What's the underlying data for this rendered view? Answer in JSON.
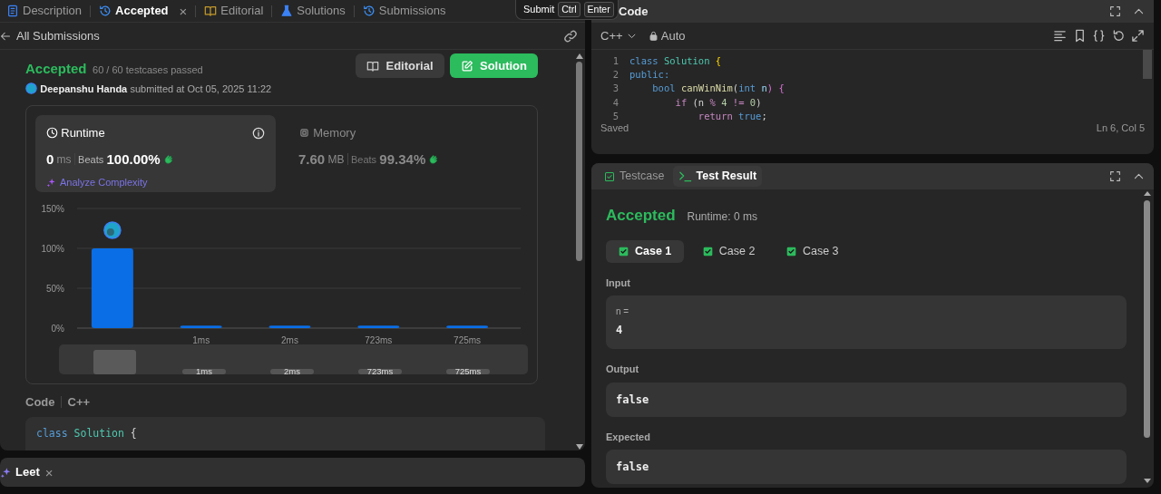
{
  "left_tabs": [
    {
      "label": "Description",
      "kind": "description",
      "selected": false,
      "closable": false
    },
    {
      "label": "Accepted",
      "kind": "history",
      "selected": true,
      "closable": true,
      "close": "×"
    },
    {
      "label": "Editorial",
      "kind": "book",
      "selected": false,
      "closable": false
    },
    {
      "label": "Solutions",
      "kind": "flask",
      "selected": false,
      "closable": false
    },
    {
      "label": "Submissions",
      "kind": "history",
      "selected": false,
      "closable": false
    }
  ],
  "back_link": "All Submissions",
  "submission": {
    "status": "Accepted",
    "testcases": "60 / 60 testcases passed",
    "author": "Deepanshu Handa",
    "submitted": "submitted at Oct 05, 2025 11:22"
  },
  "actions": [
    {
      "label": "Editorial",
      "kind": "secondary"
    },
    {
      "label": "Solution",
      "kind": "primary"
    }
  ],
  "stats": [
    {
      "title": "Runtime",
      "kind": "clock",
      "value": "0",
      "unit": "ms",
      "beats_label": "Beats",
      "beats": "100.00%",
      "selected": true,
      "link": "Analyze Complexity"
    },
    {
      "title": "Memory",
      "kind": "chip",
      "value": "7.60",
      "unit": "MB",
      "beats_label": "Beats",
      "beats": "99.34%",
      "selected": false
    }
  ],
  "chart_data": {
    "type": "bar",
    "categories": [
      null,
      "1ms",
      "2ms",
      "723ms",
      "725ms"
    ],
    "series": [
      {
        "color": "#0a6ee6",
        "values": [
          100,
          3,
          3,
          3,
          3
        ]
      }
    ],
    "ylim": [
      0,
      150
    ],
    "yticks": [
      {
        "value": 0,
        "label": "0%"
      },
      {
        "value": 50,
        "label": "50%"
      },
      {
        "value": 100,
        "label": "100%"
      },
      {
        "value": 150,
        "label": "150%"
      }
    ]
  },
  "navigator_labels": [
    "1ms",
    "2ms",
    "723ms",
    "725ms"
  ],
  "code_section": {
    "title": "Code",
    "language": "C++",
    "lines": [
      [
        {
          "text": "class",
          "kind": "keyword"
        },
        {
          "text": " Solution",
          "kind": "type"
        },
        {
          "text": " {",
          "kind": "plain"
        }
      ]
    ]
  },
  "bottom_tabs": [
    {
      "label": "Leet",
      "close": "×"
    }
  ],
  "tooltip": {
    "label": "Submit",
    "keys": [
      "Ctrl",
      "Enter"
    ]
  },
  "editor": {
    "title": "Code",
    "language": "C++",
    "mode": "Auto",
    "status": "Saved",
    "position": "Ln 6, Col 5",
    "lines": [
      {
        "number": "1",
        "tokens": [
          {
            "text": "class",
            "kind": "keyword"
          },
          {
            "text": " Solution",
            "kind": "type"
          },
          {
            "text": " {",
            "kind": "bracket"
          }
        ]
      },
      {
        "number": "2",
        "tokens": [
          {
            "text": "public:",
            "kind": "keyword"
          }
        ]
      },
      {
        "number": "3",
        "tokens": [
          {
            "text": "    bool",
            "kind": "keyword"
          },
          {
            "text": " canWinNim",
            "kind": "func"
          },
          {
            "text": "(",
            "kind": "plain"
          },
          {
            "text": "int",
            "kind": "keyword"
          },
          {
            "text": " n",
            "kind": "var"
          },
          {
            "text": ") {",
            "kind": "bracket2"
          }
        ]
      },
      {
        "number": "4",
        "tokens": [
          {
            "text": "        if",
            "kind": "control"
          },
          {
            "text": " (n",
            "kind": "plain"
          },
          {
            "text": " %",
            "kind": "control"
          },
          {
            "text": " 4",
            "kind": "number"
          },
          {
            "text": " !=",
            "kind": "control"
          },
          {
            "text": " 0",
            "kind": "number"
          },
          {
            "text": ")",
            "kind": "plain"
          }
        ]
      },
      {
        "number": "5",
        "tokens": [
          {
            "text": "            return",
            "kind": "control"
          },
          {
            "text": " true",
            "kind": "keyword"
          },
          {
            "text": ";",
            "kind": "plain"
          }
        ]
      }
    ]
  },
  "result_tabs": [
    {
      "label": "Testcase",
      "kind": "check",
      "selected": false
    },
    {
      "label": "Test Result",
      "kind": "terminal",
      "selected": true
    }
  ],
  "result": {
    "status": "Accepted",
    "runtime": "Runtime: 0 ms",
    "cases": [
      {
        "label": "Case 1",
        "selected": true,
        "passed": true
      },
      {
        "label": "Case 2",
        "selected": false,
        "passed": true
      },
      {
        "label": "Case 3",
        "selected": false,
        "passed": true
      }
    ],
    "input_label": "Input",
    "inputs": [
      {
        "name": "n =",
        "value": "4"
      }
    ],
    "output_label": "Output",
    "output": "false",
    "expected_label": "Expected",
    "expected": "false"
  }
}
